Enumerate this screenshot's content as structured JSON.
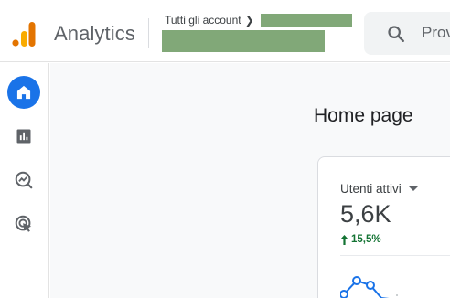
{
  "header": {
    "app_title": "Analytics",
    "breadcrumb_label": "Tutti gli account",
    "search_placeholder": "Prov"
  },
  "sidebar": {
    "items": [
      {
        "icon": "home-icon",
        "active": true
      },
      {
        "icon": "reports-icon",
        "active": false
      },
      {
        "icon": "explore-icon",
        "active": false
      },
      {
        "icon": "advertising-icon",
        "active": false
      }
    ]
  },
  "main": {
    "page_title": "Home page",
    "card": {
      "metric_label": "Utenti attivi",
      "metric_value": "5,6K",
      "change": "15,5%",
      "change_direction": "up"
    }
  },
  "colors": {
    "accent": "#1a73e8",
    "logo_orange": "#f9ab00",
    "logo_dark": "#e37400",
    "positive": "#137333",
    "redaction": "#81a878"
  }
}
